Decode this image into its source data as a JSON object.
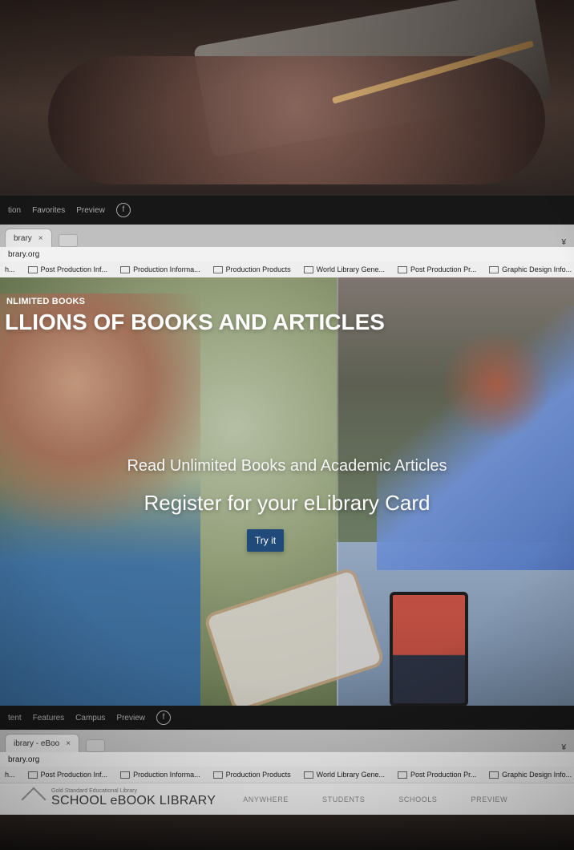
{
  "top_nav": {
    "items": [
      "tion",
      "Favorites",
      "Preview"
    ],
    "social_icon": "facebook-icon"
  },
  "browser_top": {
    "tab_title": "brary",
    "tab_close": "×",
    "url": "brary.org",
    "menu_icon": "¥",
    "bookmarks": [
      "h...",
      "Post Production Inf...",
      "Production Informa...",
      "Production Products",
      "World Library Gene...",
      "Post Production Pr...",
      "Graphic Design Info..."
    ]
  },
  "hero": {
    "eyebrow": "NLIMITED BOOKS",
    "headline": "LLIONS OF BOOKS AND ARTICLES",
    "subhead1": "Read Unlimited Books and Academic Articles",
    "subhead2": "Register for your eLibrary Card",
    "cta": "Try it"
  },
  "bottom_nav": {
    "items": [
      "tent",
      "Features",
      "Campus",
      "Preview"
    ],
    "social_icon": "facebook-icon"
  },
  "browser_bottom": {
    "tab_title": "ibrary - eBoo",
    "tab_close": "×",
    "url": "brary.org",
    "menu_icon": "¥",
    "bookmarks": [
      "h...",
      "Post Production Inf...",
      "Production Informa...",
      "Production Products",
      "World Library Gene...",
      "Post Production Pr...",
      "Graphic Design Info..."
    ]
  },
  "site": {
    "logo_sub": "Gold Standard Educational Library",
    "logo_title": "SCHOOL eBOOK LIBRARY",
    "nav": [
      "ANYWHERE",
      "STUDENTS",
      "SCHOOLS",
      "PREVIEW"
    ]
  }
}
